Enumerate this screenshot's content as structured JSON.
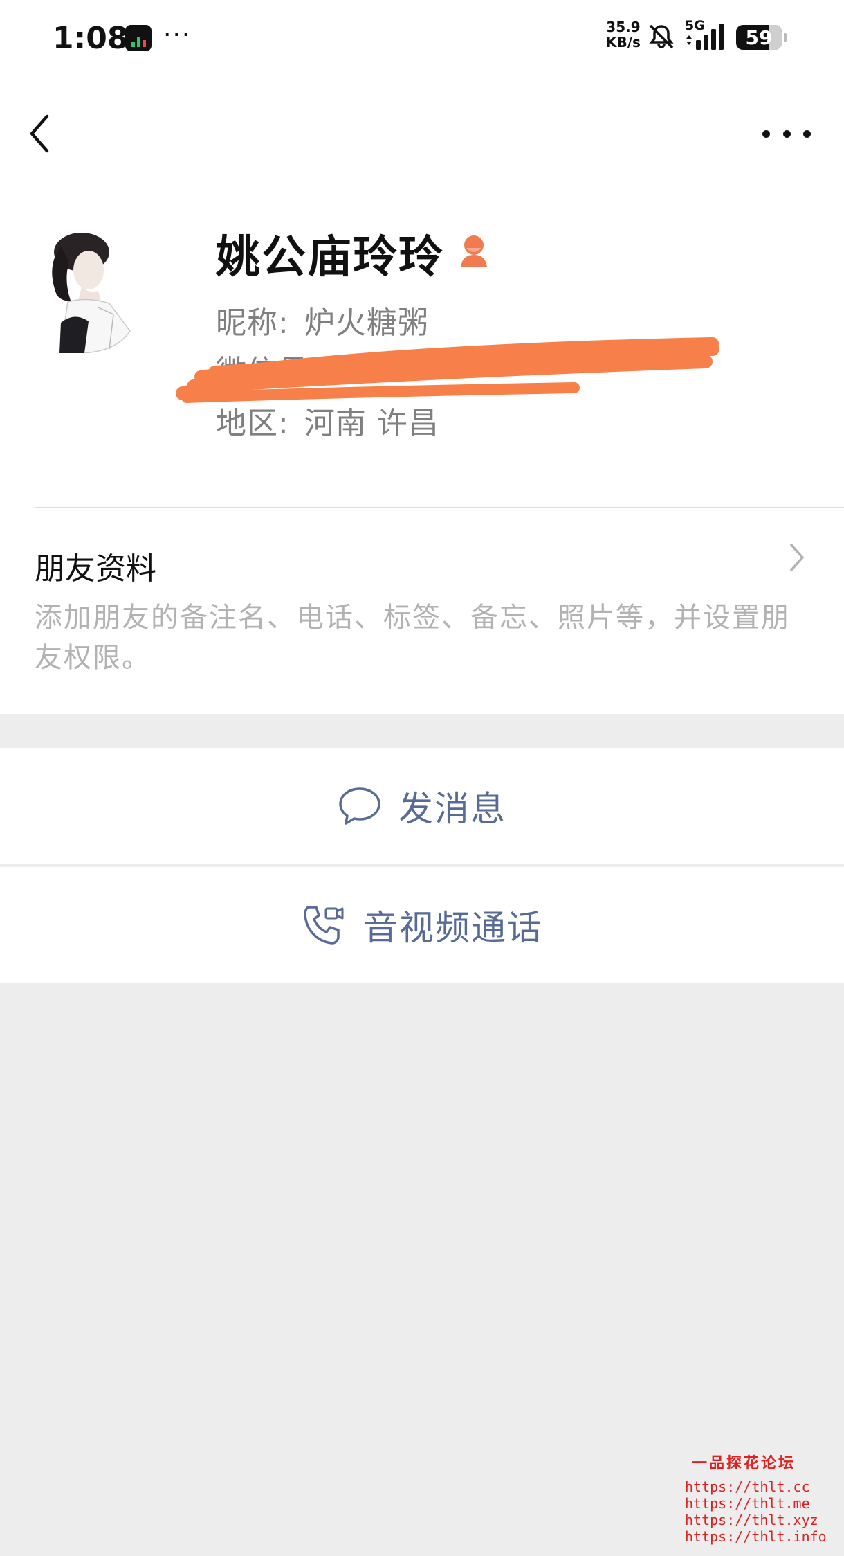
{
  "status_bar": {
    "time": "1:08",
    "more_dots": "···",
    "speed_value": "35.9",
    "speed_unit": "KB/s",
    "network": "5G",
    "battery": "59"
  },
  "profile": {
    "remark_name": "姚公庙玲玲",
    "nickname_label": "昵称:",
    "nickname_value": "炉火糖粥",
    "wechat_id_label": "微信号:",
    "region_label": "地区:",
    "region_value": "河南  许昌",
    "gender_color": "#f07b50"
  },
  "friend_info": {
    "title": "朋友资料",
    "description": "添加朋友的备注名、电话、标签、备忘、照片等，并设置朋友权限。"
  },
  "actions": {
    "message_label": "发消息",
    "call_label": "音视频通话"
  },
  "watermark": {
    "title": "一品探花论坛",
    "urls": [
      "https://thlt.cc",
      "https://thlt.me",
      "https://thlt.xyz",
      "https://thlt.info"
    ]
  },
  "colors": {
    "link_blue": "#576b95",
    "redaction": "#f7804a",
    "background": "#ededed"
  }
}
